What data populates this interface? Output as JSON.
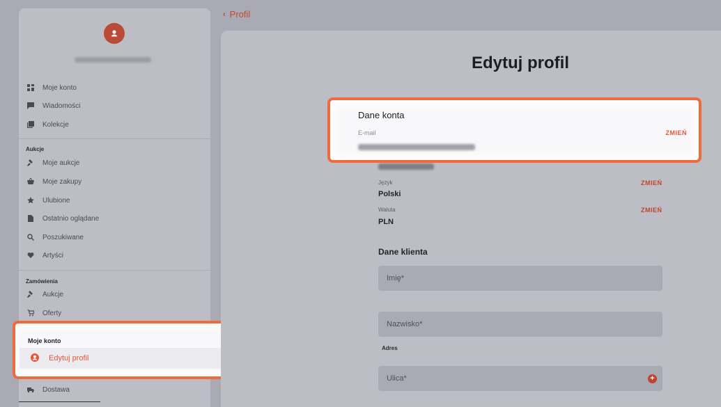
{
  "back": {
    "label": "Profil"
  },
  "sidebar": {
    "items_top": [
      {
        "label": "Moje konto",
        "icon": "dashboard-icon"
      },
      {
        "label": "Wiadomości",
        "icon": "message-icon"
      },
      {
        "label": "Kolekcje",
        "icon": "collection-icon"
      }
    ],
    "aukcje_head": "Aukcje",
    "items_aukcje": [
      {
        "label": "Moje aukcje",
        "icon": "gavel-icon"
      },
      {
        "label": "Moje zakupy",
        "icon": "basket-icon"
      },
      {
        "label": "Ulubione",
        "icon": "star-icon"
      },
      {
        "label": "Ostatnio oglądane",
        "icon": "document-icon"
      },
      {
        "label": "Poszukiwane",
        "icon": "search-icon"
      },
      {
        "label": "Artyści",
        "icon": "heart-icon"
      }
    ],
    "zamowienia_head": "Zamówienia",
    "items_zamowienia": [
      {
        "label": "Aukcje",
        "icon": "gavel-icon"
      },
      {
        "label": "Oferty",
        "icon": "cart-icon"
      }
    ],
    "moje_konto_head": "Moje konto",
    "active_item": "Edytuj profil",
    "dostawa": "Dostawa"
  },
  "main": {
    "title": "Edytuj profil",
    "dane_konta": {
      "title": "Dane konta",
      "email_label": "E-mail",
      "change": "ZMIEŃ"
    },
    "jezyk": {
      "label": "Język",
      "value": "Polski",
      "change": "ZMIEŃ"
    },
    "waluta": {
      "label": "Waluta",
      "value": "PLN",
      "change": "ZMIEŃ"
    },
    "dane_klienta": {
      "title": "Dane klienta",
      "imie_placeholder": "Imię*",
      "nazwisko_placeholder": "Nazwisko*",
      "adres_label": "Adres",
      "ulica_placeholder": "Ulica*"
    }
  },
  "colors": {
    "accent": "#e9553b",
    "highlight_border": "#f06a3b"
  }
}
